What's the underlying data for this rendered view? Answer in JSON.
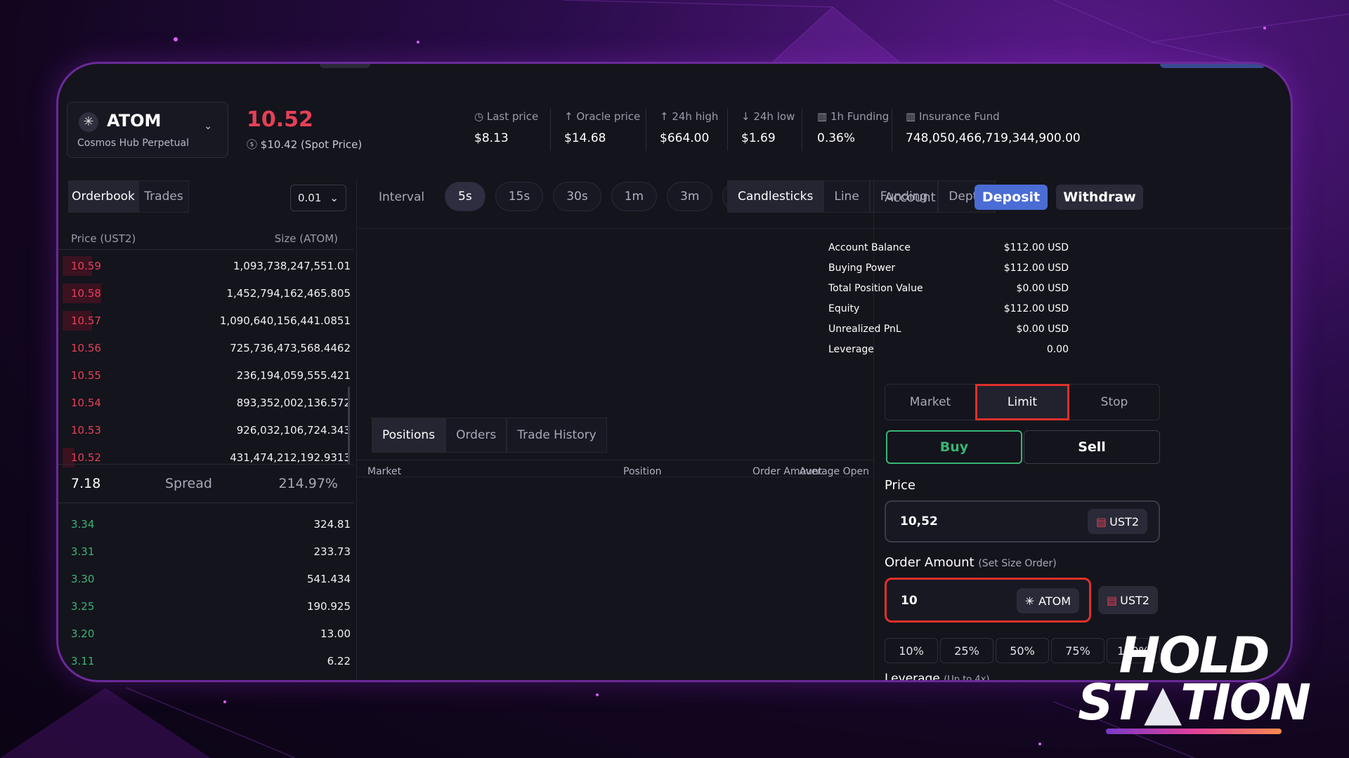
{
  "header": {
    "asset_symbol": "ATOM",
    "asset_name": "Cosmos Hub Perpetual",
    "last_trade_price": "10.52",
    "spot_price": "$10.42 (Spot Price)",
    "stats": [
      {
        "label": "Last price",
        "value": "$8.13",
        "icon": "clock-icon"
      },
      {
        "label": "Oracle price",
        "value": "$14.68",
        "icon": "arrow-up-icon"
      },
      {
        "label": "24h high",
        "value": "$664.00",
        "icon": "arrow-up-icon"
      },
      {
        "label": "24h low",
        "value": "$1.69",
        "icon": "arrow-down-icon"
      },
      {
        "label": "1h Funding",
        "value": "0.36%",
        "icon": "bar-chart-icon"
      },
      {
        "label": "Insurance Fund",
        "value": "748,050,466,719,344,900.00",
        "icon": "bar-chart-icon"
      }
    ]
  },
  "orderbook": {
    "tabs": [
      "Orderbook",
      "Trades"
    ],
    "precision": "0.01",
    "col_price": "Price (UST2)",
    "col_size": "Size (ATOM)",
    "asks": [
      {
        "price": "10.59",
        "size": "1,093,738,247,551.01",
        "depth": 0.1
      },
      {
        "price": "10.58",
        "size": "1,452,794,162,465.805",
        "depth": 0.13
      },
      {
        "price": "10.57",
        "size": "1,090,640,156,441.0851",
        "depth": 0.1
      },
      {
        "price": "10.56",
        "size": "725,736,473,568.4462",
        "depth": 0
      },
      {
        "price": "10.55",
        "size": "236,194,059,555.421",
        "depth": 0
      },
      {
        "price": "10.54",
        "size": "893,352,002,136.572",
        "depth": 0
      },
      {
        "price": "10.53",
        "size": "926,032,106,724.343",
        "depth": 0
      },
      {
        "price": "10.52",
        "size": "431,474,212,192.9313",
        "depth": 0.04
      }
    ],
    "spread": {
      "value": "7.18",
      "label": "Spread",
      "percent": "214.97%"
    },
    "bids": [
      {
        "price": "3.34",
        "size": "324.81"
      },
      {
        "price": "3.31",
        "size": "233.73"
      },
      {
        "price": "3.30",
        "size": "541.434"
      },
      {
        "price": "3.25",
        "size": "190.925"
      },
      {
        "price": "3.20",
        "size": "13.00"
      },
      {
        "price": "3.11",
        "size": "6.22"
      }
    ]
  },
  "chart": {
    "interval_label": "Interval",
    "intervals": [
      "5s",
      "15s",
      "30s",
      "1m",
      "3m",
      "5m"
    ],
    "active_interval": "5s",
    "views": [
      "Candlesticks",
      "Line",
      "Funding",
      "Depth"
    ],
    "active_view": "Candlesticks"
  },
  "positions": {
    "tabs": [
      "Positions",
      "Orders",
      "Trade History"
    ],
    "columns": [
      "Market",
      "Position",
      "Order Amount",
      "Average Open"
    ]
  },
  "account": {
    "title": "Account",
    "deposit_label": "Deposit",
    "withdraw_label": "Withdraw",
    "rows": [
      {
        "label": "Account Balance",
        "value": "$112.00 USD"
      },
      {
        "label": "Buying Power",
        "value": "$112.00 USD"
      },
      {
        "label": "Total Position Value",
        "value": "$0.00 USD"
      },
      {
        "label": "Equity",
        "value": "$112.00 USD"
      },
      {
        "label": "Unrealized PnL",
        "value": "$0.00 USD"
      },
      {
        "label": "Leverage",
        "value": "0.00"
      }
    ],
    "order_types": [
      "Market",
      "Limit",
      "Stop"
    ],
    "active_order_type": "Limit",
    "buy_label": "Buy",
    "sell_label": "Sell",
    "price_label": "Price",
    "price_value": "10,52",
    "price_token": "UST2",
    "amount_label": "Order Amount",
    "amount_hint": "(Set Size Order)",
    "amount_value": "10",
    "amount_token": "ATOM",
    "alt_token": "UST2",
    "percents": [
      "10%",
      "25%",
      "50%",
      "75%",
      "100%"
    ],
    "leverage_label": "Leverage",
    "leverage_hint": "(Up to 4x)"
  },
  "logo": {
    "line1": "HOLD",
    "line2": "ST",
    "line2b": "TION"
  },
  "colors": {
    "accent_red": "#e54057",
    "accent_green": "#3ab474",
    "deposit_blue": "#4a6cd4",
    "highlight": "#e0302a"
  }
}
